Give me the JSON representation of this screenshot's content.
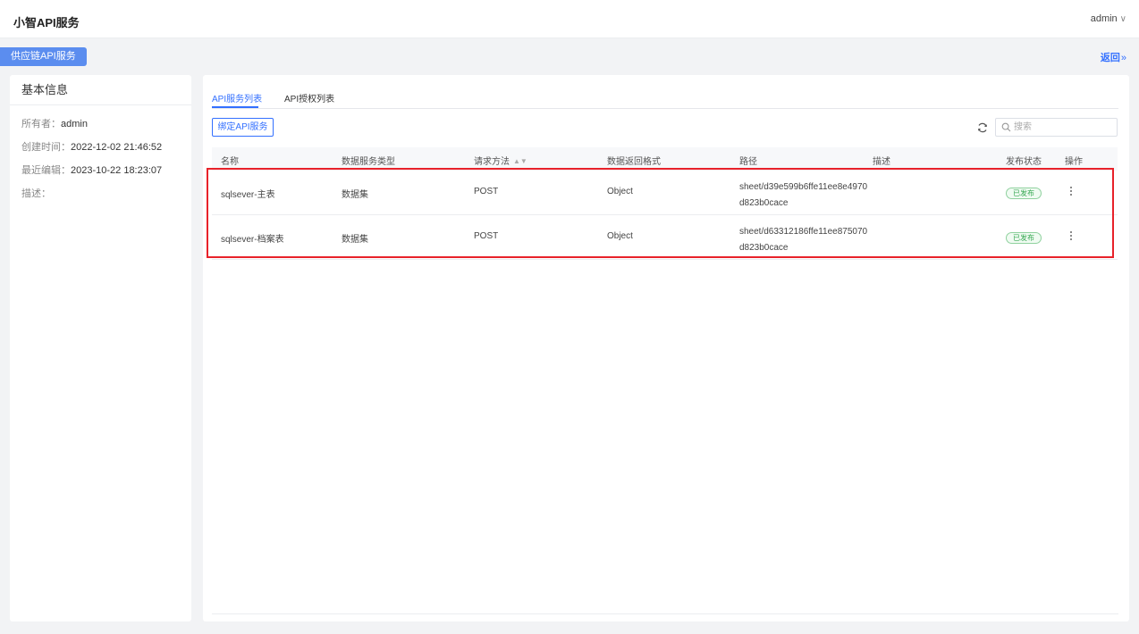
{
  "app": {
    "title": "小智API服务"
  },
  "user": {
    "name": "admin",
    "chevron": "chevron-down-icon"
  },
  "service_tag": "供应链API服务",
  "back": {
    "label": "返回",
    "icon": "double-chevron-right-icon"
  },
  "info": {
    "title": "基本信息",
    "rows": [
      {
        "key": "所有者：",
        "value": "admin"
      },
      {
        "key": "创建时间：",
        "value": "2022-12-02 21:46:52"
      },
      {
        "key": "最近编辑：",
        "value": "2023-10-22 18:23:07"
      },
      {
        "key": "描述：",
        "value": ""
      }
    ]
  },
  "tabs": [
    {
      "label": "API服务列表",
      "active": true
    },
    {
      "label": "API授权列表",
      "active": false
    }
  ],
  "toolbar": {
    "bind_label": "绑定API服务",
    "refresh_icon": "refresh-icon",
    "search_placeholder": "搜索",
    "search_value": ""
  },
  "table": {
    "headers": {
      "name": "名称",
      "type": "数据服务类型",
      "method": "请求方法",
      "format": "数据返回格式",
      "path": "路径",
      "desc": "描述",
      "status": "发布状态",
      "action": "操作"
    },
    "rows": [
      {
        "name": "sqlsever-主表",
        "type": "数据集",
        "method": "POST",
        "format": "Object",
        "path_line1": "sheet/d39e599b6ffe11ee8e4970",
        "path_line2": "d823b0cace",
        "desc": "",
        "status": "已发布"
      },
      {
        "name": "sqlsever-档案表",
        "type": "数据集",
        "method": "POST",
        "format": "Object",
        "path_line1": "sheet/d63312186ffe11ee875070",
        "path_line2": "d823b0cace",
        "desc": "",
        "status": "已发布"
      }
    ]
  },
  "colors": {
    "accent": "#3370ff",
    "tag_bg": "#5b8def",
    "highlight": "#e8222a",
    "status_green": "#36a852"
  }
}
